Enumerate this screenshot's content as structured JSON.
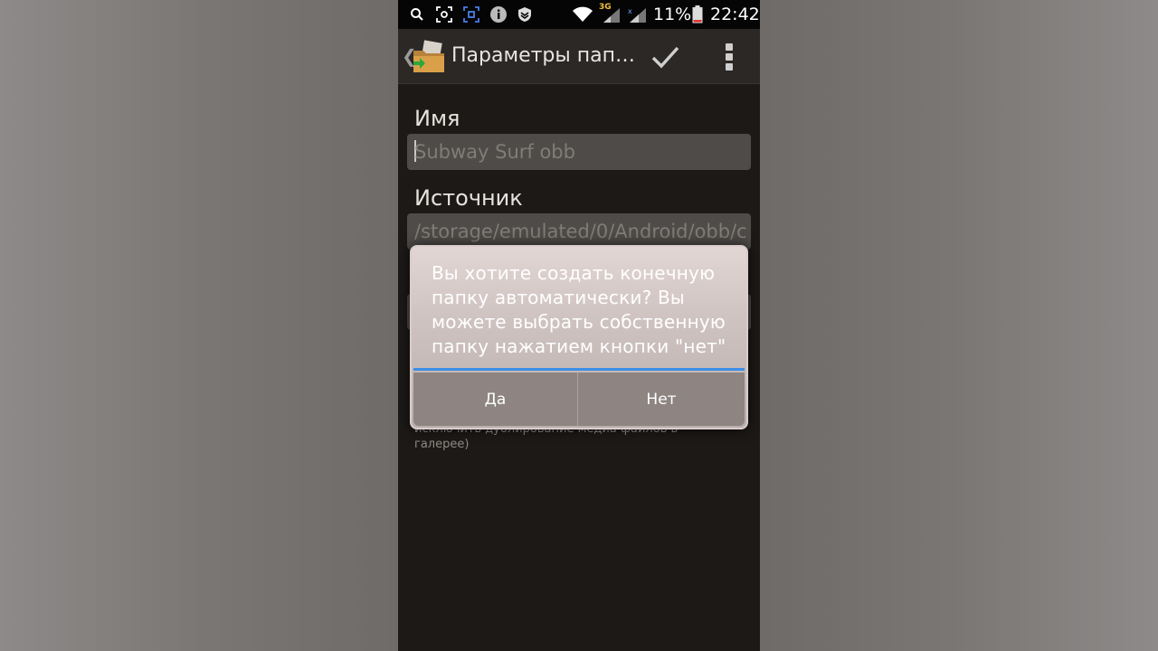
{
  "status_bar": {
    "icons": [
      "search-icon",
      "screenshot-icon",
      "screenshot-alt-icon",
      "info-icon",
      "shield-icon",
      "wifi-icon",
      "signal-3g-icon",
      "signal-no-service-icon",
      "battery-icon"
    ],
    "network_label": "3G",
    "battery_percent": "11%",
    "time": "22:42"
  },
  "action_bar": {
    "title": "Параметры пап…",
    "icons": [
      "back-chevron-icon",
      "folder-app-icon",
      "checkmark-icon",
      "overflow-menu-icon"
    ]
  },
  "form": {
    "name_label": "Имя",
    "name_placeholder": "Subway Surf obb",
    "source_label": "Источник",
    "source_value": "/storage/emulated/0/Android/obb/c",
    "description_partial": "исключить дублирование медиа файлов в галерее)"
  },
  "dialog": {
    "message": "Вы хотите создать конечную папку автоматически? Вы можете выбрать собственную папку нажатием кнопки \"нет\"",
    "yes_label": "Да",
    "no_label": "Нет",
    "accent_color": "#3d8ee8"
  }
}
